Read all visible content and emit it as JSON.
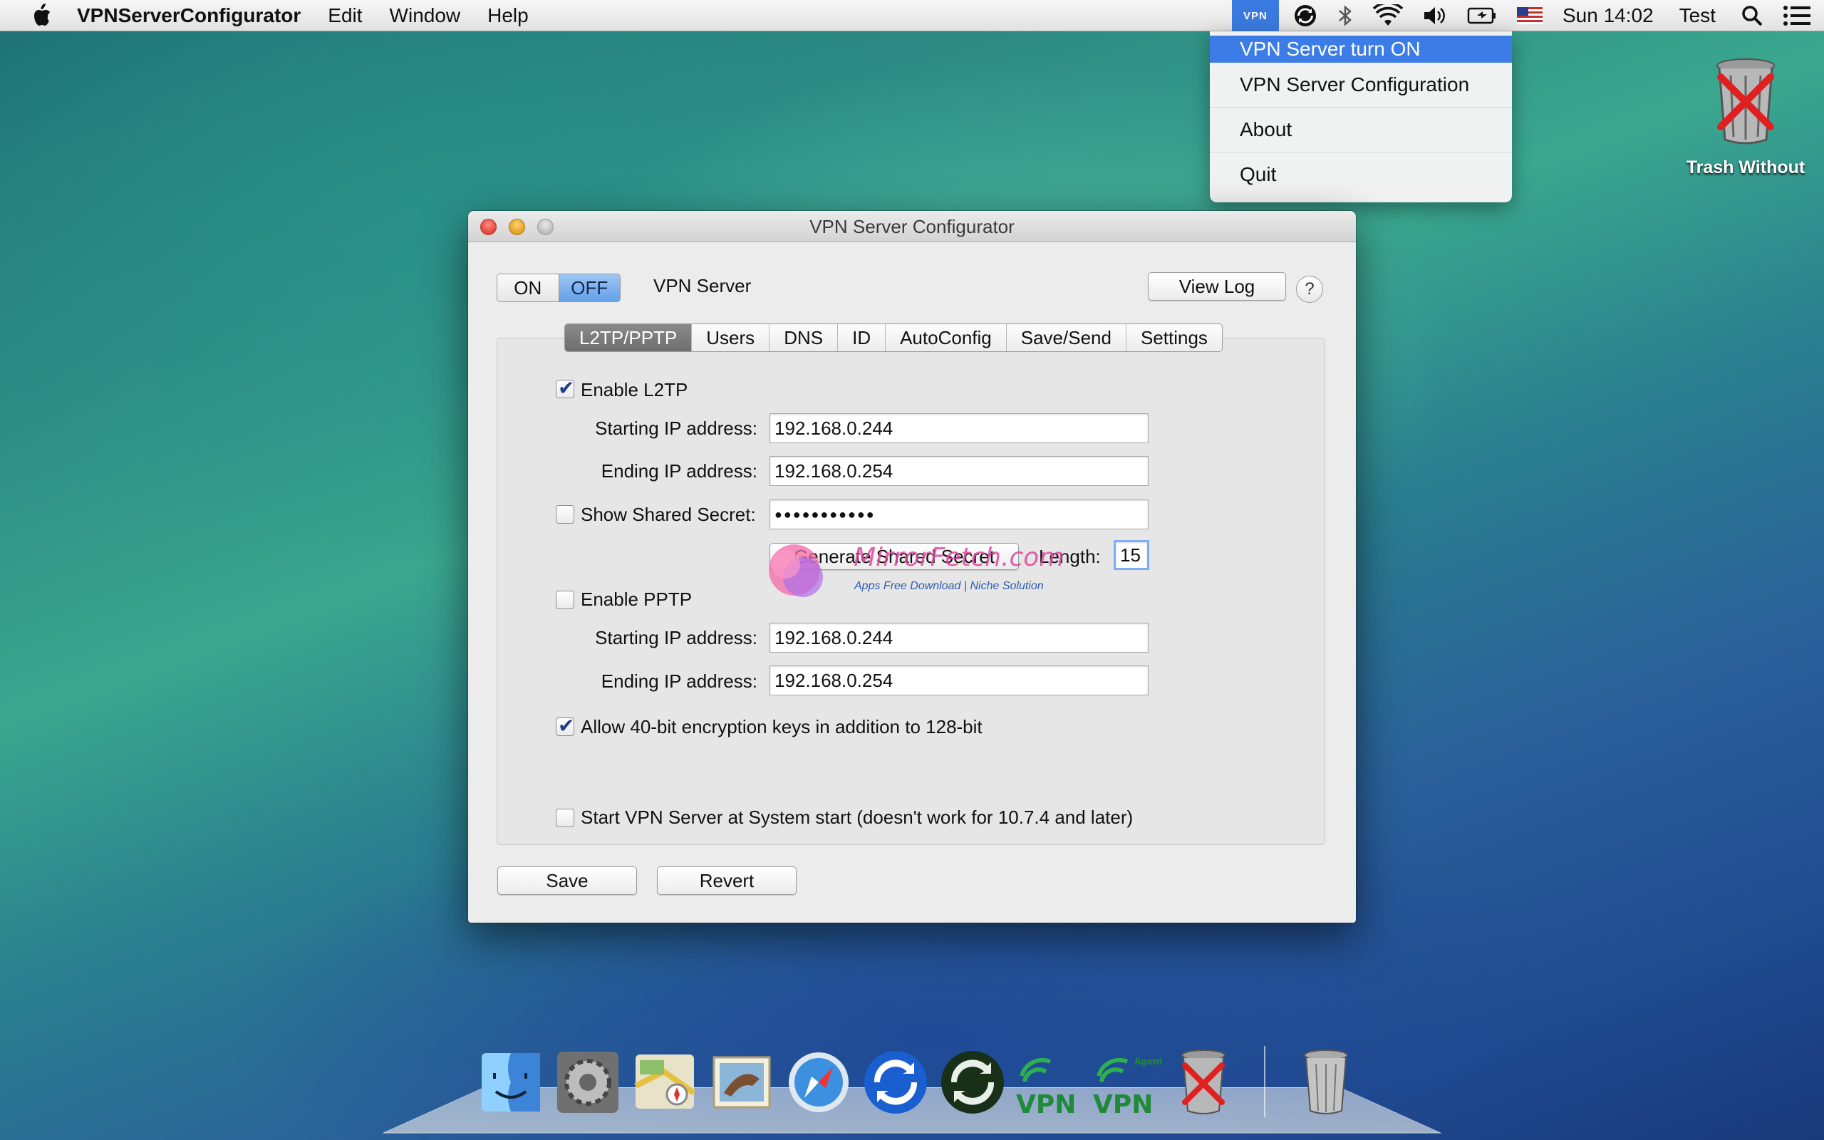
{
  "menubar": {
    "apple_icon": "apple-icon",
    "app_name": "VPNServerConfigurator",
    "menus": [
      "Edit",
      "Window",
      "Help"
    ],
    "status": {
      "vpn_label": "VPN",
      "clock": "Sun 14:02",
      "user": "Test"
    }
  },
  "status_menu": {
    "items": [
      "VPN Server turn ON",
      "VPN Server Configuration",
      "About",
      "Quit"
    ]
  },
  "desktop": {
    "trash_label": "Trash Without"
  },
  "window": {
    "title": "VPN Server Configurator",
    "toggle": {
      "on": "ON",
      "off": "OFF",
      "selected": "OFF"
    },
    "server_label": "VPN Server",
    "view_log": "View Log",
    "help": "?",
    "tabs": [
      "L2TP/PPTP",
      "Users",
      "DNS",
      "ID",
      "AutoConfig",
      "Save/Send",
      "Settings"
    ],
    "active_tab": "L2TP/PPTP",
    "l2tp": {
      "enable_label": "Enable L2TP",
      "enabled": true,
      "start_label": "Starting IP address:",
      "start_value": "192.168.0.244",
      "end_label": "Ending IP address:",
      "end_value": "192.168.0.254",
      "show_secret_label": "Show Shared Secret:",
      "show_secret": false,
      "secret_value": "●●●●●●●●●●●",
      "generate_button": "Generate Shared Secret",
      "length_label": "Length:",
      "length_value": "15"
    },
    "pptp": {
      "enable_label": "Enable PPTP",
      "enabled": false,
      "start_label": "Starting IP address:",
      "start_value": "192.168.0.244",
      "end_label": "Ending IP address:",
      "end_value": "192.168.0.254"
    },
    "encryption_label": "Allow 40-bit encryption keys in addition to 128-bit",
    "encryption_enabled": true,
    "startup_label": "Start VPN Server at System start (doesn't work for 10.7.4 and later)",
    "startup_enabled": false,
    "save": "Save",
    "revert": "Revert"
  },
  "watermark": {
    "text": "MirrorFetch.com",
    "sub": "Apps Free Download | Niche Solution"
  },
  "dock": {
    "icons": [
      "finder-icon",
      "system-preferences-icon",
      "maps-icon",
      "mail-icon",
      "safari-icon",
      "sync-icon",
      "sync-icon",
      "vpn-icon",
      "vpn-agent-icon",
      "trash-without-icon",
      "trash-icon"
    ]
  },
  "colors": {
    "selection": "#3b7ce6",
    "toggle_active": "#64a0e8",
    "tab_active": "#6e6e6e"
  }
}
